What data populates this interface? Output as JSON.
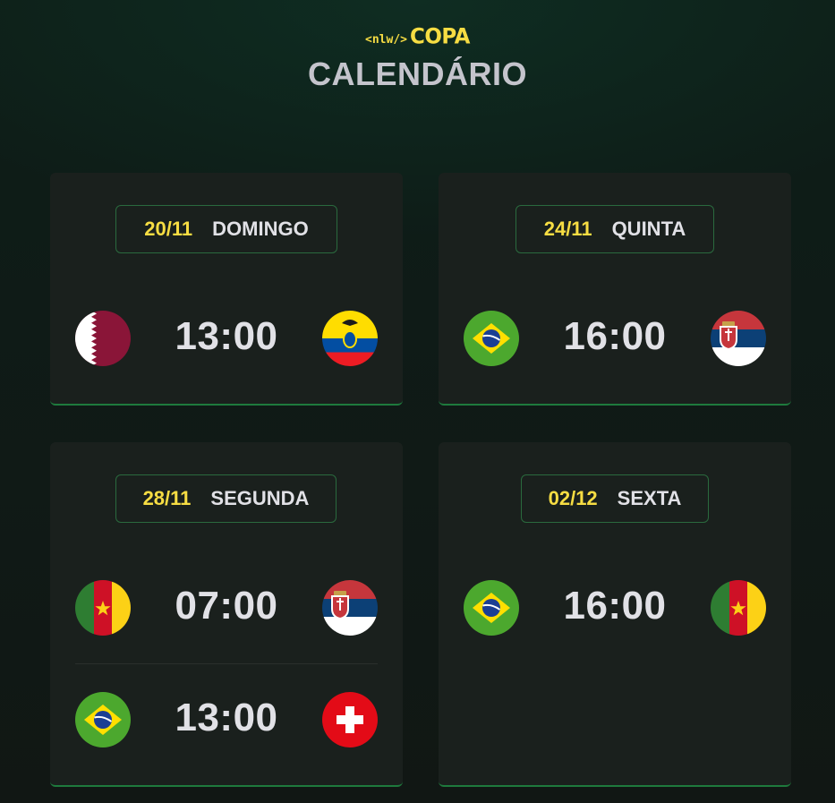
{
  "header": {
    "logo_tag": "<nlw/>",
    "logo_text": "COPA",
    "title": "CALENDÁRIO"
  },
  "cards": [
    {
      "date": "20/11",
      "weekday": "DOMINGO",
      "matches": [
        {
          "home_flag": "qatar-flag",
          "time": "13:00",
          "away_flag": "ecuador-flag"
        }
      ]
    },
    {
      "date": "24/11",
      "weekday": "QUINTA",
      "matches": [
        {
          "home_flag": "brazil-flag",
          "time": "16:00",
          "away_flag": "serbia-flag"
        }
      ]
    },
    {
      "date": "28/11",
      "weekday": "SEGUNDA",
      "matches": [
        {
          "home_flag": "cameroon-flag",
          "time": "07:00",
          "away_flag": "serbia-flag"
        },
        {
          "home_flag": "brazil-flag",
          "time": "13:00",
          "away_flag": "switzerland-flag"
        }
      ]
    },
    {
      "date": "02/12",
      "weekday": "SEXTA",
      "matches": [
        {
          "home_flag": "brazil-flag",
          "time": "16:00",
          "away_flag": "cameroon-flag"
        }
      ]
    }
  ],
  "colors": {
    "accent_yellow": "#f7dd43",
    "card_bg": "#1a201d",
    "border_green": "#1e7a3d"
  }
}
